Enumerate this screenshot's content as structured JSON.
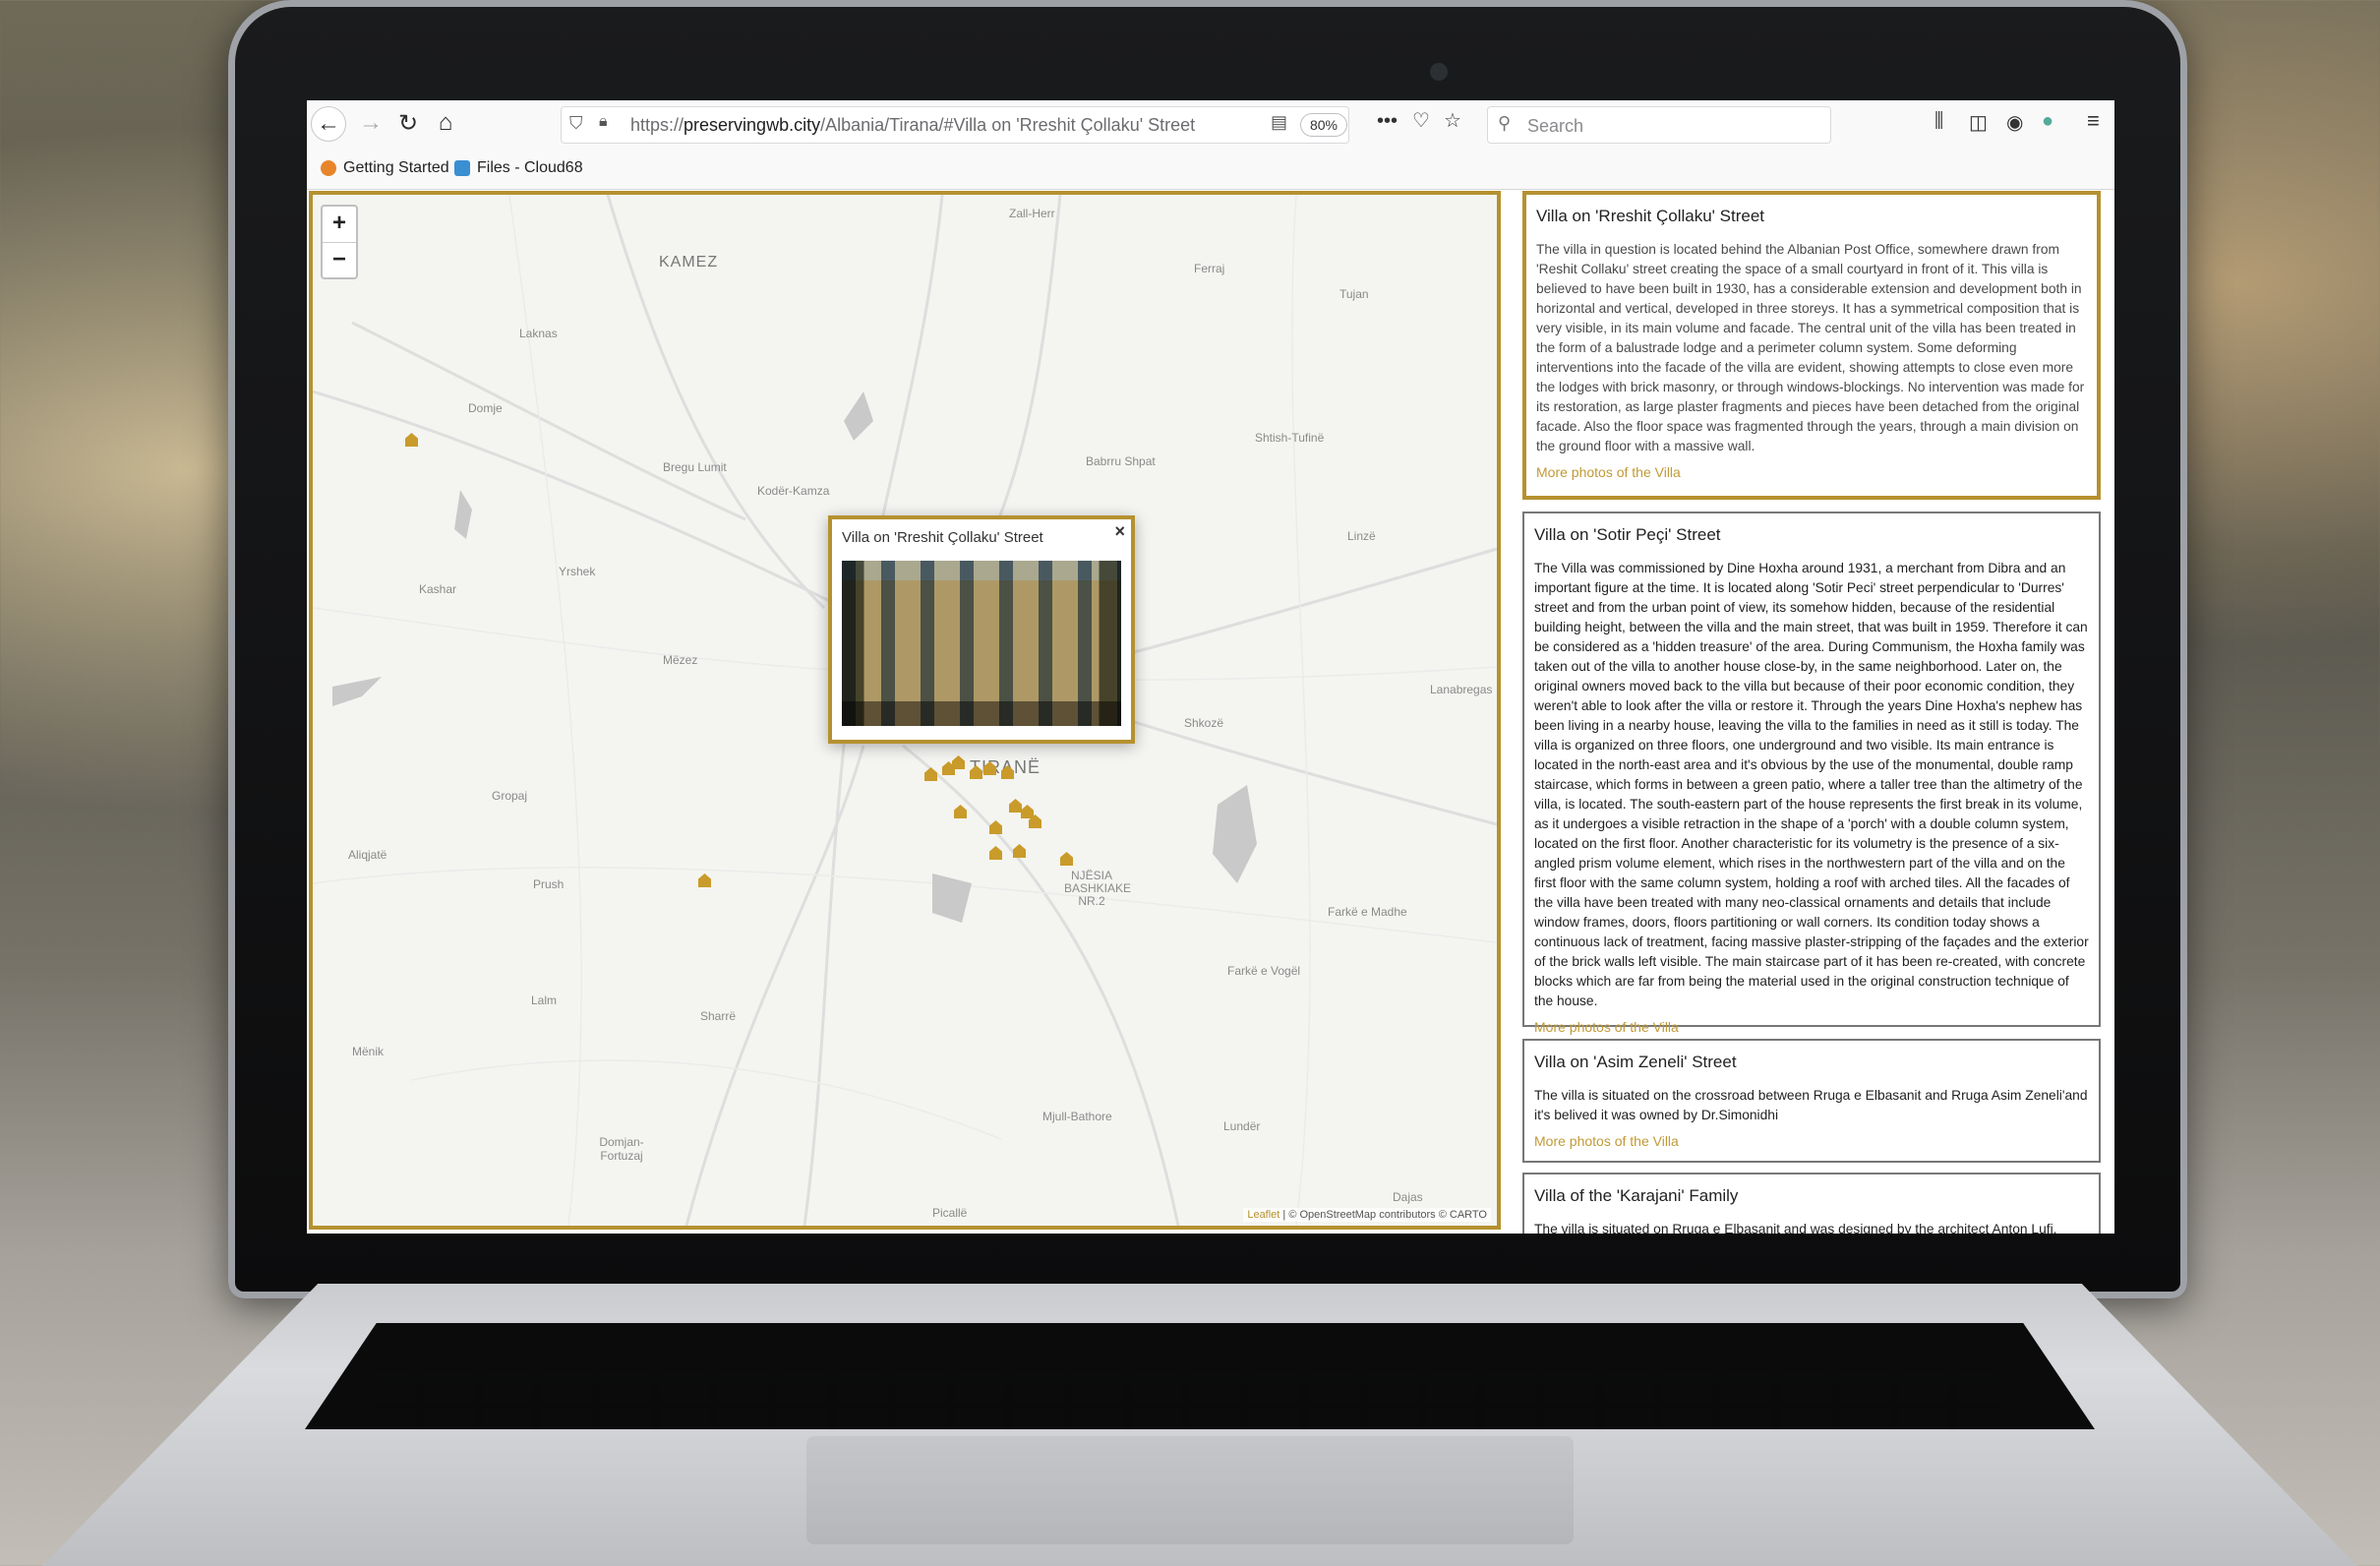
{
  "browser": {
    "url_prefix": "https://",
    "url_domain": "preservingwb.city",
    "url_path": "/Albania/Tirana/#Villa on 'Rreshit Çollaku' Street",
    "zoom": "80%",
    "search_placeholder": "Search",
    "bookmarks": [
      "Getting Started",
      "Files - Cloud68"
    ]
  },
  "map": {
    "zoom_in": "+",
    "zoom_out": "−",
    "labels": [
      "Zall-Herr",
      "KAMEZ",
      "Ferraj",
      "Tujan",
      "Laknas",
      "Domje",
      "Shtish-Tufinë",
      "Bregu Lumit",
      "Babrru Shpat",
      "Kodër-Kamza",
      "Linzë",
      "Yrshek",
      "Kashar",
      "Mëzez",
      "Lanabregas",
      "Shkozë",
      "Gropaj",
      "Aliqjatë",
      "Prush",
      "NJËSIA BASHKIAKE NR.2",
      "Farkë e Madhe",
      "Farkë e Vogël",
      "Lalm",
      "Sharrë",
      "Mënik",
      "Mjull-Bathore",
      "Lundër",
      "Domjan-Fortuzaj",
      "Dajas",
      "Picallë",
      "TIRANË"
    ],
    "attribution_leaflet": "Leaflet",
    "attribution_rest": " | © OpenStreetMap contributors © CARTO",
    "popup": {
      "title": "Villa on 'Rreshit Çollaku' Street",
      "close": "×"
    }
  },
  "villas": [
    {
      "title": "Villa on 'Rreshit Çollaku' Street",
      "text": "The villa in question is located behind the Albanian Post Office, somewhere drawn from 'Reshit Collaku' street creating the space of a small courtyard in front of it. This villa is believed to have been built in 1930, has a considerable extension and development both in horizontal and vertical, developed in three storeys. It has a symmetrical composition that is very visible, in its main volume and facade. The central unit of the villa has been treated in the form of a balustrade lodge and a perimeter column system. Some deforming interventions into the facade of the villa are evident, showing attempts to close even more the lodges with brick masonry, or through windows-blockings. No intervention was made for its restoration, as large plaster fragments and pieces have been detached from the original facade. Also the floor space was fragmented through the years, through a main division on the ground floor with a massive wall.",
      "link": "More photos of the Villa"
    },
    {
      "title": "Villa on 'Sotir Peçi' Street",
      "text": "The Villa was commissioned by Dine Hoxha around 1931, a merchant from Dibra and an important figure at the time. It is located along 'Sotir Peci' street perpendicular to 'Durres' street and from the urban point of view, its somehow hidden, because of the residential building height, between the villa and the main street, that was built in 1959. Therefore it can be considered as a 'hidden treasure' of the area. During Communism, the Hoxha family was taken out of the villa to another house close-by, in the same neighborhood. Later on, the original owners moved back to the villa but because of their poor economic condition, they weren't able to look after the villa or restore it. Through the years Dine Hoxha's nephew has been living in a nearby house, leaving the villa to the families in need as it still is today. The villa is organized on three floors, one underground and two visible. Its main entrance is located in the north-east area and it's obvious by the use of the monumental, double ramp staircase, which forms in between a green patio, where a taller tree than the altimetry of the villa, is located. The south-eastern part of the house represents the first break in its volume, as it undergoes a visible retraction in the shape of a 'porch' with a double column system, located on the first floor. Another characteristic for its volumetry is the presence of a six-angled prism volume element, which rises in the northwestern part of the villa and on the first floor with the same column system, holding a roof with arched tiles. All the facades of the villa have been treated with many neo-classical ornaments and details that include window frames, doors, floors partitioning or wall corners. Its condition today shows a continuous lack of treatment, facing massive plaster-stripping of the façades and the exterior of the brick walls left visible. The main staircase part of it has been re-created, with concrete blocks which are far from being the material used in the original construction technique of the house.",
      "link": "More photos of the Villa"
    },
    {
      "title": "Villa on 'Asim Zeneli' Street",
      "text": "The villa is situated on the crossroad between Rruga e Elbasanit and Rruga Asim Zeneli'and it's belived it was owned by Dr.Simonidhi",
      "link": "More photos of the Villa"
    },
    {
      "title": "Villa of the 'Karajani' Family",
      "text": "The villa is situated on Rruga e Elbasanit and was designed by the architect Anton Lufi.",
      "link": ""
    }
  ],
  "colors": {
    "accent": "#b5912f",
    "pin": "#c99b2a",
    "link": "#c19a36"
  }
}
